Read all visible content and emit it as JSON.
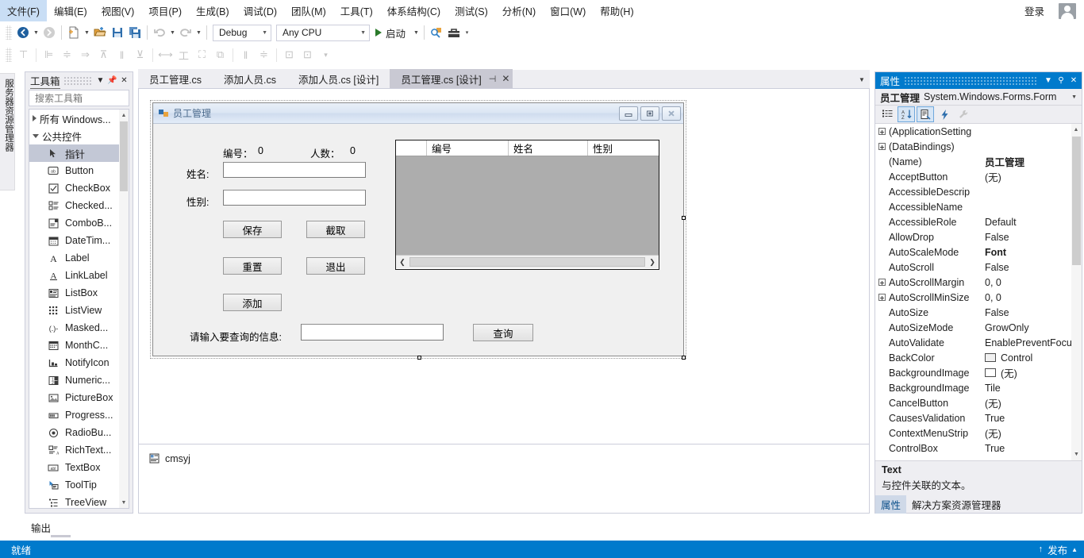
{
  "menu": {
    "items": [
      "文件(F)",
      "编辑(E)",
      "视图(V)",
      "项目(P)",
      "生成(B)",
      "调试(D)",
      "团队(M)",
      "工具(T)",
      "体系结构(C)",
      "测试(S)",
      "分析(N)",
      "窗口(W)",
      "帮助(H)"
    ],
    "signin_label": "登录",
    "avatar_icon": "user-avatar-icon"
  },
  "toolbar": {
    "nav_back_icon": "navigate-back-icon",
    "nav_forward_icon": "navigate-forward-icon",
    "new_item_icon": "new-item-icon",
    "open_icon": "open-file-icon",
    "save_icon": "save-icon",
    "save_all_icon": "save-all-icon",
    "undo_icon": "undo-icon",
    "redo_icon": "redo-icon",
    "config_value": "Debug",
    "platform_value": "Any CPU",
    "start_label": "启动",
    "start_icon": "play-icon",
    "find_icon": "find-in-files-icon",
    "toolbox_icon": "toolbox-icon",
    "overflow_icon": "toolbar-overflow-icon"
  },
  "layout_toolbar": {
    "icons": [
      "align-lefts-icon",
      "align-centers-icon",
      "align-rights-icon",
      "align-tops-icon",
      "align-middles-icon",
      "align-bottoms-icon",
      "make-same-width-icon",
      "make-same-height-icon",
      "make-same-size-icon",
      "size-to-grid-icon",
      "horizontal-spacing-icon",
      "vertical-spacing-icon",
      "center-horizontally-icon",
      "center-vertically-icon"
    ]
  },
  "server_explorer_dock": {
    "label": "服务器资源管理器"
  },
  "toolbox": {
    "title": "工具箱",
    "dropdown_icon": "chevron-down-icon",
    "pin_icon": "pin-icon",
    "close_icon": "close-icon",
    "search_placeholder": "搜索工具箱",
    "search_value": "",
    "search_icon": "search-icon",
    "search_dropdown_icon": "chevron-down-icon",
    "groups": [
      {
        "label": "所有 Windows...",
        "expanded": false
      },
      {
        "label": "公共控件",
        "expanded": true
      }
    ],
    "items": [
      {
        "label": "指针",
        "icon": "pointer-icon",
        "selected": true
      },
      {
        "label": "Button",
        "icon": "button-icon",
        "selected": false
      },
      {
        "label": "CheckBox",
        "icon": "checkbox-icon",
        "selected": false
      },
      {
        "label": "Checked...",
        "icon": "checkedlistbox-icon",
        "selected": false
      },
      {
        "label": "ComboB...",
        "icon": "combobox-icon",
        "selected": false
      },
      {
        "label": "DateTim...",
        "icon": "datetimepicker-icon",
        "selected": false
      },
      {
        "label": "Label",
        "icon": "label-icon",
        "selected": false
      },
      {
        "label": "LinkLabel",
        "icon": "linklabel-icon",
        "selected": false
      },
      {
        "label": "ListBox",
        "icon": "listbox-icon",
        "selected": false
      },
      {
        "label": "ListView",
        "icon": "listview-icon",
        "selected": false
      },
      {
        "label": "Masked...",
        "icon": "maskedtextbox-icon",
        "selected": false
      },
      {
        "label": "MonthC...",
        "icon": "monthcalendar-icon",
        "selected": false
      },
      {
        "label": "NotifyIcon",
        "icon": "notifyicon-icon",
        "selected": false
      },
      {
        "label": "Numeric...",
        "icon": "numericupdown-icon",
        "selected": false
      },
      {
        "label": "PictureBox",
        "icon": "picturebox-icon",
        "selected": false
      },
      {
        "label": "Progress...",
        "icon": "progressbar-icon",
        "selected": false
      },
      {
        "label": "RadioBu...",
        "icon": "radiobutton-icon",
        "selected": false
      },
      {
        "label": "RichText...",
        "icon": "richtextbox-icon",
        "selected": false
      },
      {
        "label": "TextBox",
        "icon": "textbox-icon",
        "selected": false
      },
      {
        "label": "ToolTip",
        "icon": "tooltip-icon",
        "selected": false
      },
      {
        "label": "TreeView",
        "icon": "treeview-icon",
        "selected": false
      }
    ]
  },
  "editor_tabs": {
    "tabs": [
      {
        "label": "员工管理.cs",
        "active": false
      },
      {
        "label": "添加人员.cs",
        "active": false
      },
      {
        "label": "添加人员.cs [设计]",
        "active": false
      },
      {
        "label": "员工管理.cs [设计]",
        "active": true
      }
    ],
    "pin_icon": "pin-icon",
    "close_icon": "close-icon",
    "overflow_icon": "chevron-down-icon"
  },
  "form": {
    "title": "员工管理",
    "title_icon": "winform-icon",
    "minimize_icon": "minimize-icon",
    "maximize_icon": "maximize-icon",
    "close_icon": "close-icon",
    "labels": {
      "id_label": "编号：",
      "id_value": "0",
      "count_label": "人数：",
      "count_value": "0",
      "name_label": "姓名:",
      "gender_label": "性别:",
      "query_label": "请输入要查询的信息:"
    },
    "inputs": {
      "name_value": "",
      "gender_value": "",
      "query_value": ""
    },
    "buttons": {
      "save": "保存",
      "capture": "截取",
      "reset": "重置",
      "exit": "退出",
      "add": "添加",
      "query": "查询"
    },
    "grid": {
      "columns": [
        "编号",
        "姓名",
        "性别"
      ],
      "rows": [],
      "hscroll_left_icon": "chevron-left-icon",
      "hscroll_right_icon": "chevron-right-icon"
    }
  },
  "component_tray": {
    "label": "cmsyj",
    "icon": "component-icon"
  },
  "properties": {
    "title": "属性",
    "dropdown_icon": "chevron-down-icon",
    "pin_icon": "pin-icon",
    "close_icon": "close-icon",
    "object_name": "员工管理",
    "object_type": "System.Windows.Forms.Form",
    "object_dropdown_icon": "chevron-down-icon",
    "tools": [
      {
        "icon": "categorized-icon",
        "active": false
      },
      {
        "icon": "alphabetical-sort-icon",
        "active": true
      },
      {
        "icon": "properties-page-icon",
        "active": true
      },
      {
        "icon": "events-lightning-icon",
        "active": false
      },
      {
        "icon": "property-pages-wrench-icon",
        "active": false
      }
    ],
    "rows": [
      {
        "name": "(ApplicationSetting",
        "value": "",
        "expandable": true,
        "bold": false,
        "swatch": null
      },
      {
        "name": "(DataBindings)",
        "value": "",
        "expandable": true,
        "bold": false,
        "swatch": null
      },
      {
        "name": "(Name)",
        "value": "员工管理",
        "expandable": false,
        "bold": true,
        "swatch": null
      },
      {
        "name": "AcceptButton",
        "value": "(无)",
        "expandable": false,
        "bold": false,
        "swatch": null
      },
      {
        "name": "AccessibleDescrip",
        "value": "",
        "expandable": false,
        "bold": false,
        "swatch": null
      },
      {
        "name": "AccessibleName",
        "value": "",
        "expandable": false,
        "bold": false,
        "swatch": null
      },
      {
        "name": "AccessibleRole",
        "value": "Default",
        "expandable": false,
        "bold": false,
        "swatch": null
      },
      {
        "name": "AllowDrop",
        "value": "False",
        "expandable": false,
        "bold": false,
        "swatch": null
      },
      {
        "name": "AutoScaleMode",
        "value": "Font",
        "expandable": false,
        "bold": true,
        "swatch": null
      },
      {
        "name": "AutoScroll",
        "value": "False",
        "expandable": false,
        "bold": false,
        "swatch": null
      },
      {
        "name": "AutoScrollMargin",
        "value": "0, 0",
        "expandable": true,
        "bold": false,
        "swatch": null
      },
      {
        "name": "AutoScrollMinSize",
        "value": "0, 0",
        "expandable": true,
        "bold": false,
        "swatch": null
      },
      {
        "name": "AutoSize",
        "value": "False",
        "expandable": false,
        "bold": false,
        "swatch": null
      },
      {
        "name": "AutoSizeMode",
        "value": "GrowOnly",
        "expandable": false,
        "bold": false,
        "swatch": null
      },
      {
        "name": "AutoValidate",
        "value": "EnablePreventFocus",
        "expandable": false,
        "bold": false,
        "swatch": null
      },
      {
        "name": "BackColor",
        "value": "Control",
        "expandable": false,
        "bold": false,
        "swatch": "#f0f0f0"
      },
      {
        "name": "BackgroundImage",
        "value": "(无)",
        "expandable": false,
        "bold": false,
        "swatch": "#ffffff"
      },
      {
        "name": "BackgroundImage",
        "value": "Tile",
        "expandable": false,
        "bold": false,
        "swatch": null
      },
      {
        "name": "CancelButton",
        "value": "(无)",
        "expandable": false,
        "bold": false,
        "swatch": null
      },
      {
        "name": "CausesValidation",
        "value": "True",
        "expandable": false,
        "bold": false,
        "swatch": null
      },
      {
        "name": "ContextMenuStrip",
        "value": "(无)",
        "expandable": false,
        "bold": false,
        "swatch": null
      },
      {
        "name": "ControlBox",
        "value": "True",
        "expandable": false,
        "bold": false,
        "swatch": null
      }
    ],
    "description": {
      "title": "Text",
      "text": "与控件关联的文本。"
    },
    "tabs": [
      {
        "label": "属性",
        "selected": true
      },
      {
        "label": "解决方案资源管理器",
        "selected": false
      }
    ]
  },
  "output_panel": {
    "tab_label": "输出"
  },
  "status_bar": {
    "text": "就绪",
    "publish_label": "发布",
    "publish_up_icon": "arrow-up-icon",
    "publish_chevron_icon": "chevron-up-icon"
  },
  "colors": {
    "accent": "#007acc",
    "panel": "#eeeef2",
    "border": "#cccedb",
    "form_face": "#f0f0f0",
    "grid_rows": "#adadad",
    "selection": "#c3c8d6"
  }
}
